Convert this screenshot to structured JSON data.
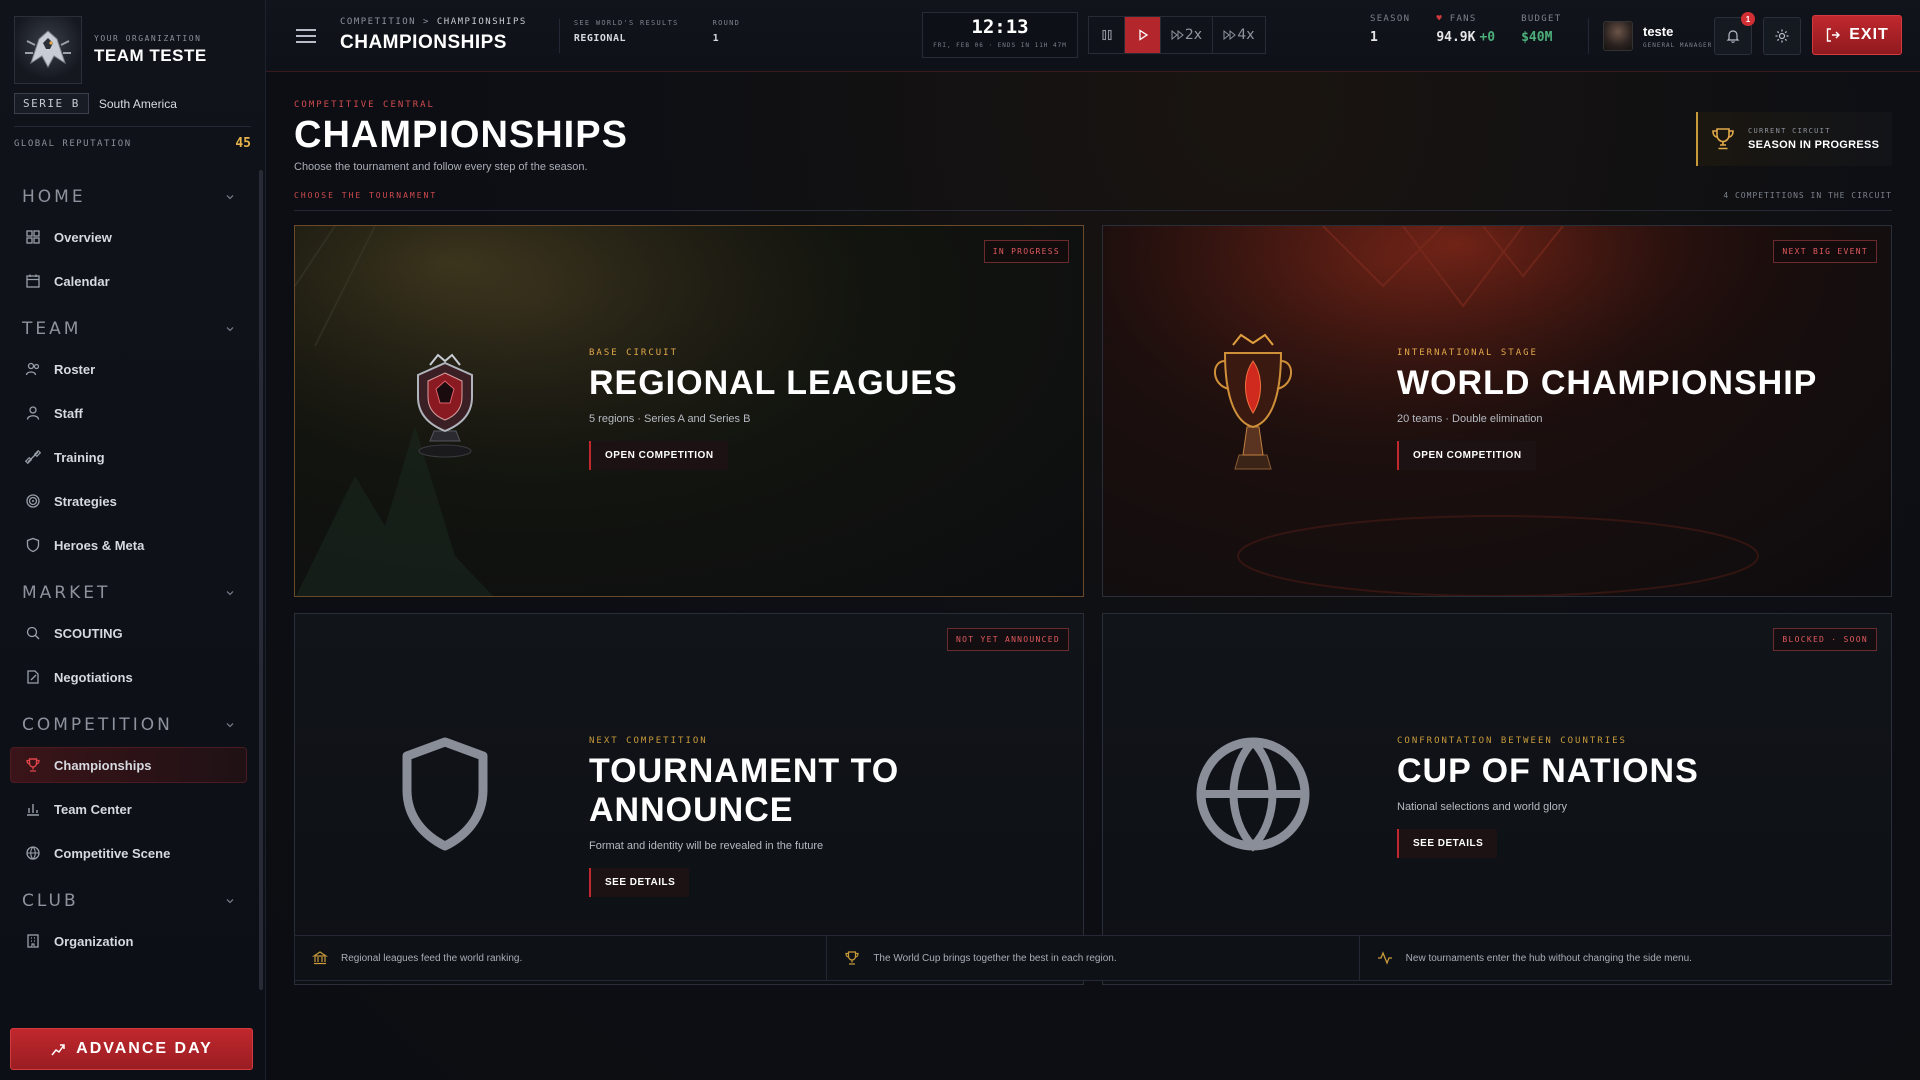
{
  "org": {
    "kicker": "YOUR ORGANIZATION",
    "name": "TEAM TESTE",
    "tier": "SERIE B",
    "region": "South America",
    "reputation_label": "GLOBAL REPUTATION",
    "reputation_value": "45"
  },
  "nav": {
    "home": {
      "label": "HOME",
      "items": [
        "Overview",
        "Calendar"
      ]
    },
    "team": {
      "label": "TEAM",
      "items": [
        "Roster",
        "Staff",
        "Training",
        "Strategies",
        "Heroes & Meta"
      ]
    },
    "market": {
      "label": "MARKET",
      "items": [
        "SCOUTING",
        "Negotiations"
      ]
    },
    "competition": {
      "label": "COMPETITION",
      "items": [
        "Championships",
        "Team Center",
        "Competitive Scene"
      ]
    },
    "club": {
      "label": "CLUB",
      "items": [
        "Organization"
      ]
    },
    "advance_label": "ADVANCE DAY"
  },
  "topbar": {
    "crumb_parent": "COMPETITION",
    "crumb_sep": ">",
    "crumb_current": "CHAMPIONSHIPS",
    "title": "CHAMPIONSHIPS",
    "results_label": "SEE WORLD'S RESULTS",
    "results_value": "REGIONAL",
    "round_label": "ROUND",
    "round_value": "1",
    "time": "12:13",
    "date": "FRI, FEB 06 · ENDS IN 11H 47M",
    "speed_2x": "2x",
    "speed_4x": "4x",
    "season_label": "SEASON",
    "season_value": "1",
    "fans_label": "FANS",
    "fans_value": "94.9K",
    "fans_delta": "+0",
    "budget_label": "BUDGET",
    "budget_value": "$40M",
    "user_name": "teste",
    "user_role": "GENERAL MANAGER",
    "notif_count": "1",
    "exit_label": "EXIT"
  },
  "page": {
    "kicker": "COMPETITIVE CENTRAL",
    "title": "CHAMPIONSHIPS",
    "subtitle": "Choose the tournament and follow every step of the season.",
    "circuit_label": "CURRENT CIRCUIT",
    "circuit_value": "SEASON IN PROGRESS",
    "choose_label": "CHOOSE THE TOURNAMENT",
    "count_label": "4 COMPETITIONS IN THE CIRCUIT"
  },
  "cards": [
    {
      "badge": "IN PROGRESS",
      "kicker": "BASE CIRCUIT",
      "title": "REGIONAL LEAGUES",
      "subtitle": "5 regions · Series A and Series B",
      "button": "OPEN COMPETITION"
    },
    {
      "badge": "NEXT BIG EVENT",
      "kicker": "INTERNATIONAL STAGE",
      "title": "WORLD CHAMPIONSHIP",
      "subtitle": "20 teams · Double elimination",
      "button": "OPEN COMPETITION"
    },
    {
      "badge": "NOT YET ANNOUNCED",
      "kicker": "NEXT COMPETITION",
      "title": "TOURNAMENT TO ANNOUNCE",
      "subtitle": "Format and identity will be revealed in the future",
      "button": "SEE DETAILS"
    },
    {
      "badge": "BLOCKED · SOON",
      "kicker": "CONFRONTATION BETWEEN COUNTRIES",
      "title": "CUP OF NATIONS",
      "subtitle": "National selections and world glory",
      "button": "SEE DETAILS"
    }
  ],
  "footer": [
    "Regional leagues feed the world ranking.",
    "The World Cup brings together the best in each region.",
    "New tournaments enter the hub without changing the side menu."
  ],
  "colors": {
    "accent_red": "#c0282d",
    "accent_gold": "#e2a94a",
    "positive": "#4caf7a"
  }
}
